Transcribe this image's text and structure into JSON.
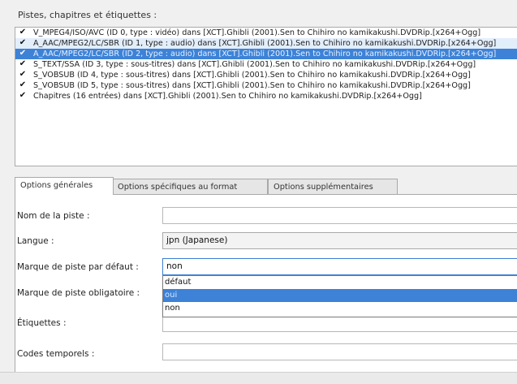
{
  "section_title": "Pistes, chapitres et étiquettes :",
  "tracks": [
    {
      "checked": true,
      "text": "V_MPEG4/ISO/AVC (ID 0, type : vidéo) dans [XCT].Ghibli (2001).Sen to Chihiro no kamikakushi.DVDRip.[x264+Ogg]",
      "state": "normal"
    },
    {
      "checked": true,
      "text": "A_AAC/MPEG2/LC/SBR (ID 1, type : audio) dans [XCT].Ghibli (2001).Sen to Chihiro no kamikakushi.DVDRip.[x264+Ogg]",
      "state": "hovered"
    },
    {
      "checked": true,
      "text": "A_AAC/MPEG2/LC/SBR (ID 2, type : audio) dans [XCT].Ghibli (2001).Sen to Chihiro no kamikakushi.DVDRip.[x264+Ogg]",
      "state": "selected"
    },
    {
      "checked": true,
      "text": "S_TEXT/SSA (ID 3, type : sous-titres) dans [XCT].Ghibli (2001).Sen to Chihiro no kamikakushi.DVDRip.[x264+Ogg]",
      "state": "normal"
    },
    {
      "checked": true,
      "text": "S_VOBSUB (ID 4, type : sous-titres) dans [XCT].Ghibli (2001).Sen to Chihiro no kamikakushi.DVDRip.[x264+Ogg]",
      "state": "normal"
    },
    {
      "checked": true,
      "text": "S_VOBSUB (ID 5, type : sous-titres) dans [XCT].Ghibli (2001).Sen to Chihiro no kamikakushi.DVDRip.[x264+Ogg]",
      "state": "normal"
    },
    {
      "checked": true,
      "text": "Chapitres (16 entrées) dans [XCT].Ghibli (2001).Sen to Chihiro no kamikakushi.DVDRip.[x264+Ogg]",
      "state": "normal"
    }
  ],
  "tabs": [
    {
      "label": "Options générales",
      "active": true
    },
    {
      "label": "Options spécifiques au format",
      "active": false
    },
    {
      "label": "Options supplémentaires",
      "active": false
    }
  ],
  "fields": {
    "track_name": {
      "label": "Nom de la piste :",
      "value": ""
    },
    "language": {
      "label": "Langue :",
      "value": "jpn (Japanese)"
    },
    "default_flag": {
      "label": "Marque de piste par défaut :",
      "value": "non"
    },
    "forced_flag": {
      "label": "Marque de piste obligatoire :",
      "value": ""
    },
    "tags": {
      "label": "Étiquettes :",
      "value": ""
    },
    "timecodes": {
      "label": "Codes temporels :",
      "value": ""
    }
  },
  "dropdown_options": [
    {
      "label": "défaut",
      "highlighted": false
    },
    {
      "label": "oui",
      "highlighted": true
    },
    {
      "label": "non",
      "highlighted": false
    }
  ],
  "check_mark": "✔"
}
